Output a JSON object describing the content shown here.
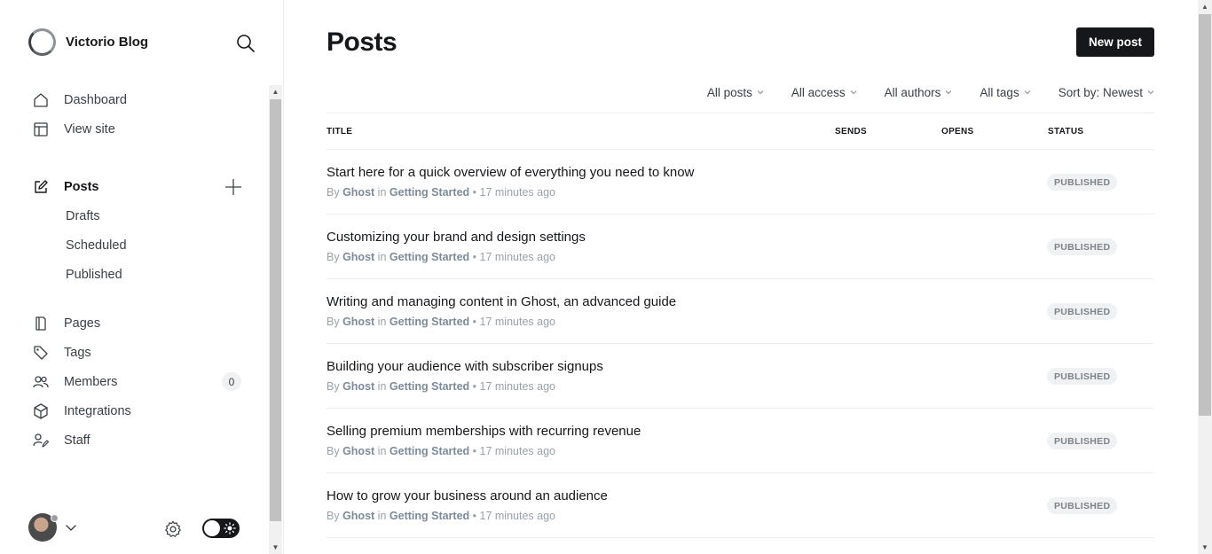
{
  "brand": {
    "name": "Victorio Blog",
    "search_icon": "search-icon"
  },
  "nav": {
    "primary": [
      {
        "label": "Dashboard",
        "icon": "home-icon"
      },
      {
        "label": "View site",
        "icon": "layout-icon"
      }
    ],
    "posts": {
      "label": "Posts",
      "icon": "edit-icon",
      "sub": [
        "Drafts",
        "Scheduled",
        "Published"
      ]
    },
    "secondary": [
      {
        "label": "Pages",
        "icon": "page-icon"
      },
      {
        "label": "Tags",
        "icon": "tag-icon"
      },
      {
        "label": "Members",
        "icon": "members-icon",
        "count": "0"
      },
      {
        "label": "Integrations",
        "icon": "cube-icon"
      },
      {
        "label": "Staff",
        "icon": "staff-icon"
      }
    ]
  },
  "footer": {
    "icons": [
      "avatar",
      "chevron-down-icon",
      "gear-icon",
      "sun-icon"
    ]
  },
  "main": {
    "title": "Posts",
    "new_post_label": "New post",
    "filters": [
      "All posts",
      "All access",
      "All authors",
      "All tags",
      "Sort by: Newest"
    ],
    "columns": {
      "title": "TITLE",
      "sends": "SENDS",
      "opens": "OPENS",
      "status": "STATUS"
    },
    "posts": [
      {
        "title": "Start here for a quick overview of everything you need to know",
        "by": "By",
        "author": "Ghost",
        "in": "in",
        "tag": "Getting Started",
        "time": "• 17 minutes ago",
        "status": "PUBLISHED"
      },
      {
        "title": "Customizing your brand and design settings",
        "by": "By",
        "author": "Ghost",
        "in": "in",
        "tag": "Getting Started",
        "time": "• 17 minutes ago",
        "status": "PUBLISHED"
      },
      {
        "title": "Writing and managing content in Ghost, an advanced guide",
        "by": "By",
        "author": "Ghost",
        "in": "in",
        "tag": "Getting Started",
        "time": "• 17 minutes ago",
        "status": "PUBLISHED"
      },
      {
        "title": "Building your audience with subscriber signups",
        "by": "By",
        "author": "Ghost",
        "in": "in",
        "tag": "Getting Started",
        "time": "• 17 minutes ago",
        "status": "PUBLISHED"
      },
      {
        "title": "Selling premium memberships with recurring revenue",
        "by": "By",
        "author": "Ghost",
        "in": "in",
        "tag": "Getting Started",
        "time": "• 17 minutes ago",
        "status": "PUBLISHED"
      },
      {
        "title": "How to grow your business around an audience",
        "by": "By",
        "author": "Ghost",
        "in": "in",
        "tag": "Getting Started",
        "time": "• 17 minutes ago",
        "status": "PUBLISHED"
      }
    ]
  },
  "colors": {
    "accent": "#15171a",
    "muted": "#99a1a9",
    "badge_bg": "#eff1f3"
  }
}
